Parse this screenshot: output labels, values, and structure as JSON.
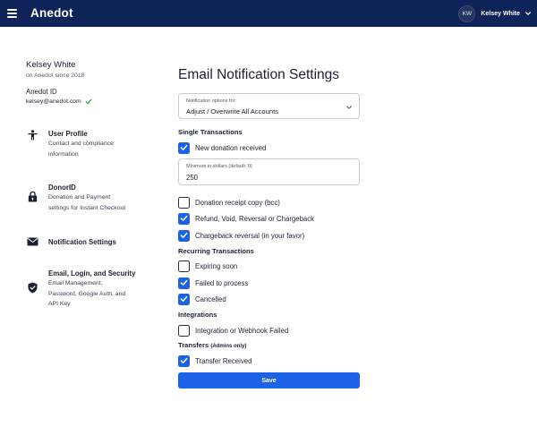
{
  "header": {
    "logo": "Anedot",
    "avatar_initials": "KW",
    "user_name": "Kelsey White",
    "bar_color": "#0e2358"
  },
  "profile": {
    "name": "Kelsey White",
    "since": "on Anedot since 2018",
    "id_label": "Anedot ID",
    "email": "kelsey@anedot.com",
    "email_verified_icon": "check-icon"
  },
  "nav": [
    {
      "title": "User Profile",
      "desc_lines": [
        "Contact and compliance",
        "information"
      ],
      "icon": "person-icon"
    },
    {
      "title": "DonorID",
      "desc_lines": [
        "Donation and Payment",
        "settings for Instant Checkout"
      ],
      "icon": "lock-icon"
    },
    {
      "title": "Notification Settings",
      "desc_lines": [],
      "icon": "envelope-icon"
    },
    {
      "title": "Email, Login, and Security",
      "desc_lines": [
        "Email Management,",
        "Password, Google Auth, and",
        "API Key"
      ],
      "icon": "shield-icon"
    }
  ],
  "main": {
    "title": "Email Notification Settings",
    "select": {
      "label": "Notification options for:",
      "value": "Adjust / Overwrite All Accounts"
    },
    "sections": {
      "single": "Single Transactions",
      "recurring": "Recurring Transactions",
      "integrations": "Integrations",
      "transfers": "Transfers",
      "transfers_note": "(Admins only)"
    },
    "minimum": {
      "label": "Minimum in dollars (default: 0)",
      "value": "250"
    },
    "options": {
      "new_donation": {
        "label": "New donation received",
        "checked": true
      },
      "receipt_copy": {
        "label": "Donation receipt copy (bcc)",
        "checked": false
      },
      "refund": {
        "label": "Refund, Void, Reversal or Chargeback",
        "checked": true
      },
      "chargeback_reversal": {
        "label": "Chargeback reversal (in your favor)",
        "checked": true
      },
      "expiring": {
        "label": "Expiring soon",
        "checked": false
      },
      "failed": {
        "label": "Failed to process",
        "checked": true
      },
      "cancelled": {
        "label": "Cancelled",
        "checked": true
      },
      "webhook_failed": {
        "label": "Integration or Webhook Failed",
        "checked": false
      },
      "transfer_received": {
        "label": "Transfer Received",
        "checked": true
      }
    },
    "save_label": "Save",
    "accent": "#1c62e8"
  }
}
